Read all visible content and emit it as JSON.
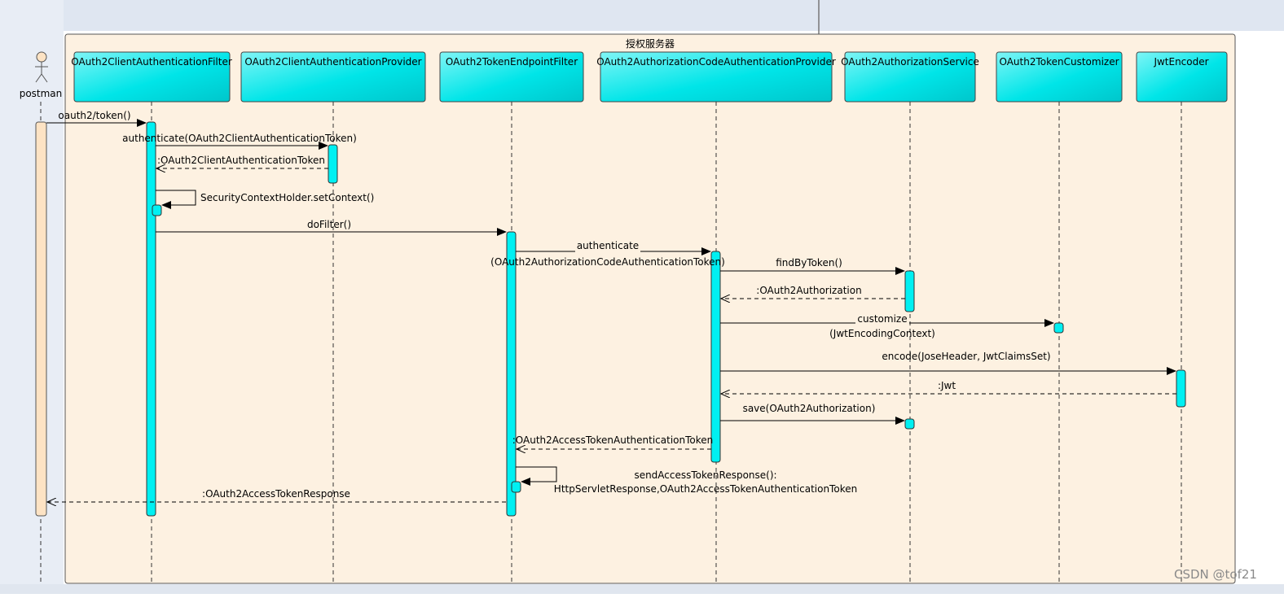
{
  "frame": {
    "title": "授权服务器"
  },
  "actor": {
    "name": "postman"
  },
  "lifelines": [
    {
      "id": "client-auth-filter",
      "label": "OAuth2ClientAuthenticationFilter"
    },
    {
      "id": "client-auth-provider",
      "label": "OAuth2ClientAuthenticationProvider"
    },
    {
      "id": "token-endpoint-filter",
      "label": "OAuth2TokenEndpointFilter"
    },
    {
      "id": "authz-code-provider",
      "label": "OAuth2AuthorizationCodeAuthenticationProvider"
    },
    {
      "id": "authorization-service",
      "label": "OAuth2AuthorizationService"
    },
    {
      "id": "token-customizer",
      "label": "OAuth2TokenCustomizer"
    },
    {
      "id": "jwt-encoder",
      "label": "JwtEncoder"
    }
  ],
  "messages": [
    {
      "id": "m1",
      "lines": [
        "oauth2/token()"
      ]
    },
    {
      "id": "m2",
      "lines": [
        "authenticate(OAuth2ClientAuthenticationToken)"
      ]
    },
    {
      "id": "m3",
      "lines": [
        ":OAuth2ClientAuthenticationToken"
      ]
    },
    {
      "id": "m4",
      "lines": [
        "SecurityContextHolder.setContext()"
      ]
    },
    {
      "id": "m5",
      "lines": [
        "doFilter()"
      ]
    },
    {
      "id": "m6",
      "lines": [
        "authenticate",
        "(OAuth2AuthorizationCodeAuthenticationToken)"
      ]
    },
    {
      "id": "m7",
      "lines": [
        "findByToken()"
      ]
    },
    {
      "id": "m8",
      "lines": [
        ":OAuth2Authorization"
      ]
    },
    {
      "id": "m9",
      "lines": [
        "customize",
        "(JwtEncodingContext)"
      ]
    },
    {
      "id": "m10",
      "lines": [
        "encode(JoseHeader, JwtClaimsSet)"
      ]
    },
    {
      "id": "m11",
      "lines": [
        ":Jwt"
      ]
    },
    {
      "id": "m12",
      "lines": [
        "save(OAuth2Authorization)"
      ]
    },
    {
      "id": "m13",
      "lines": [
        ":OAuth2AccessTokenAuthenticationToken"
      ]
    },
    {
      "id": "m14",
      "lines": [
        "sendAccessTokenResponse():",
        "HttpServletResponse,OAuth2AccessTokenAuthenticationToken"
      ]
    },
    {
      "id": "m15",
      "lines": [
        ":OAuth2AccessTokenResponse"
      ]
    }
  ],
  "watermark": "CSDN @tof21",
  "colors": {
    "frame_fill": "#fdf1e1",
    "lifeline_fill": "#00e5e8",
    "actor_bar": "#fde3c4",
    "window_bg": "#dfe6f1"
  }
}
